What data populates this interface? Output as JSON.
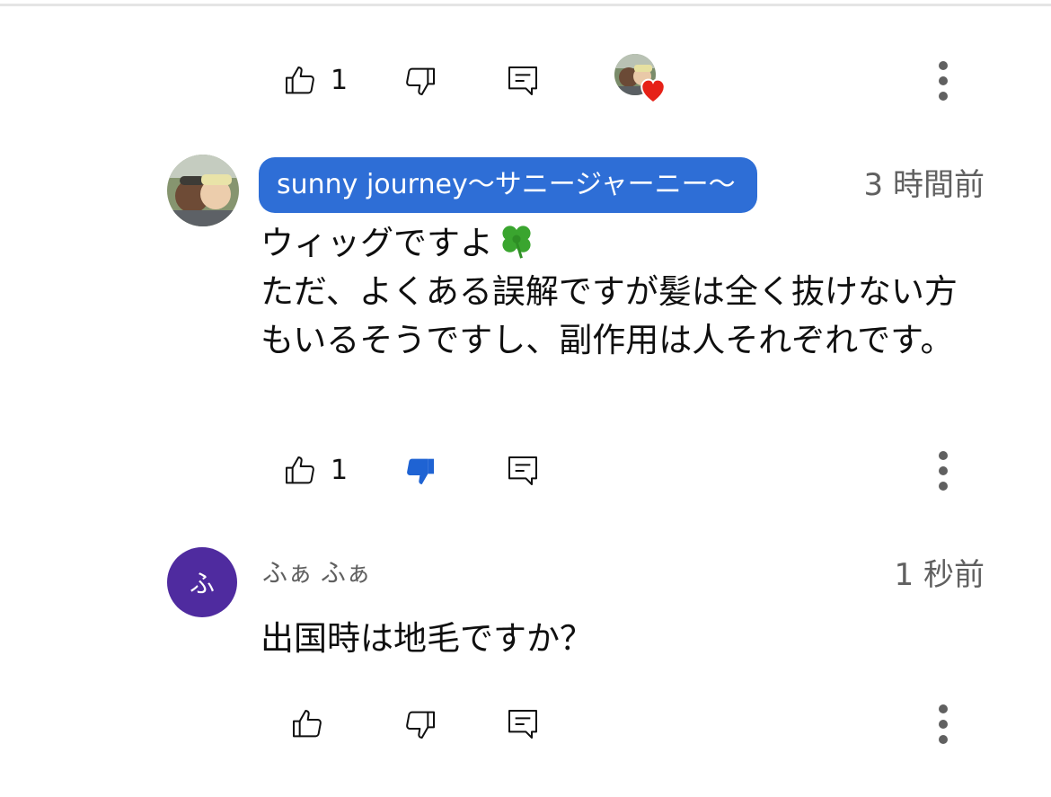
{
  "top_row": {
    "like_count": "1",
    "icons": {
      "like": "thumbs-up-outline-icon",
      "dislike": "thumbs-down-outline-icon",
      "reply": "reply-comment-icon",
      "creator_heart": "creator-heart-icon",
      "more": "more-vertical-icon"
    }
  },
  "comments": [
    {
      "author": "sunny journey～サニージャーニー～",
      "author_is_creator": true,
      "timestamp": "3 時間前",
      "text_line1": "ウィッグですよ",
      "text_rest": "ただ、よくある誤解ですが髪は全く抜けない方もいるそうですし、副作用は人それぞれです。",
      "emoji": "four-leaf-clover",
      "like_count": "1",
      "disliked": true,
      "colors": {
        "chip_bg": "#2e6ed6",
        "dislike_active": "#1f63d3"
      }
    },
    {
      "author": "ふぁ ふぁ",
      "avatar_letter": "ふ",
      "author_is_creator": false,
      "timestamp": "1 秒前",
      "text": "出国時は地毛ですか？",
      "like_count": "",
      "disliked": false,
      "colors": {
        "avatar_bg": "#4f2b9f"
      }
    }
  ],
  "colors": {
    "text_primary": "#0f0f0f",
    "text_secondary": "#606060",
    "heart": "#e62117"
  }
}
